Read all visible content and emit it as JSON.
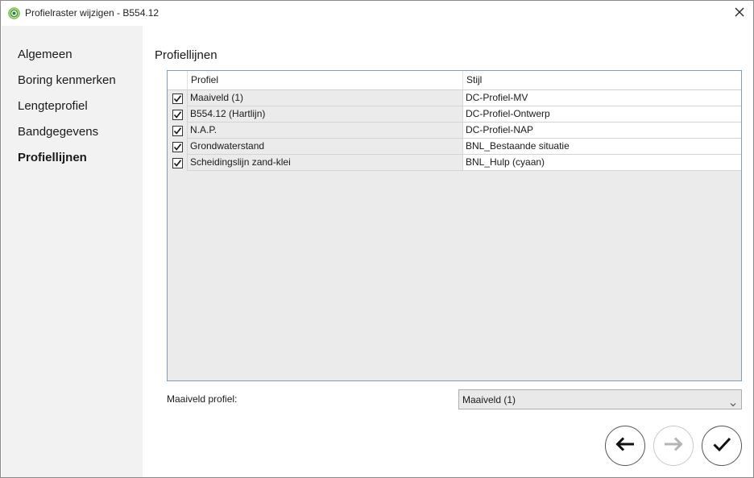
{
  "window": {
    "title": "Profielraster wijzigen - B554.12",
    "app_icon": "concentric-rings-icon",
    "close_icon": "close-icon"
  },
  "sidebar": {
    "items": [
      {
        "label": "Algemeen",
        "active": false
      },
      {
        "label": "Boring kenmerken",
        "active": false
      },
      {
        "label": "Lengteprofiel",
        "active": false
      },
      {
        "label": "Bandgegevens",
        "active": false
      },
      {
        "label": "Profiellijnen",
        "active": true
      }
    ]
  },
  "main": {
    "section_title": "Profiellijnen",
    "grid": {
      "columns": [
        "Profiel",
        "Stijl"
      ],
      "rows": [
        {
          "checked": true,
          "profiel": "Maaiveld (1)",
          "stijl": "DC-Profiel-MV"
        },
        {
          "checked": true,
          "profiel": "B554.12 (Hartlijn)",
          "stijl": "DC-Profiel-Ontwerp"
        },
        {
          "checked": true,
          "profiel": "N.A.P.",
          "stijl": "DC-Profiel-NAP"
        },
        {
          "checked": true,
          "profiel": "Grondwaterstand",
          "stijl": "BNL_Bestaande situatie"
        },
        {
          "checked": true,
          "profiel": "Scheidingslijn zand-klei",
          "stijl": "BNL_Hulp (cyaan)"
        }
      ]
    },
    "maaiveld_label": "Maaiveld profiel:",
    "maaiveld_value": "Maaiveld (1)"
  },
  "footer": {
    "back_icon": "arrow-left-icon",
    "next_icon": "arrow-right-icon",
    "next_enabled": false,
    "finish_icon": "checkmark-icon"
  },
  "colors": {
    "sidebar_bg": "#f2f2f2",
    "grid_bg": "#ebebeb",
    "grid_border": "#7f9db9",
    "icon_green": "#3a9b3a"
  }
}
